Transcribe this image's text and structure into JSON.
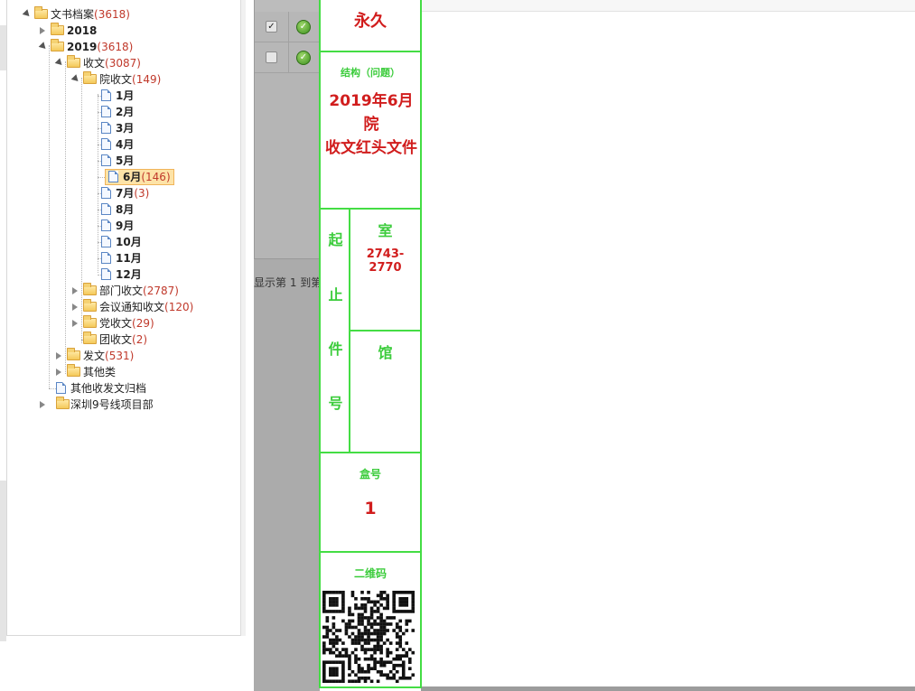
{
  "tree": {
    "root": {
      "label": "文书档案",
      "count": "(3618)"
    },
    "year_2018": {
      "label": "2018"
    },
    "year_2019": {
      "label": "2019",
      "count": "(3618)"
    },
    "receive": {
      "label": "收文",
      "count": "(3087)"
    },
    "inst_receive": {
      "label": "院收文",
      "count": "(149)"
    },
    "months": [
      {
        "label": "1月",
        "count": ""
      },
      {
        "label": "2月",
        "count": ""
      },
      {
        "label": "3月",
        "count": ""
      },
      {
        "label": "4月",
        "count": ""
      },
      {
        "label": "5月",
        "count": ""
      },
      {
        "label": "6月",
        "count": "(146)"
      },
      {
        "label": "7月",
        "count": "(3)"
      },
      {
        "label": "8月",
        "count": ""
      },
      {
        "label": "9月",
        "count": ""
      },
      {
        "label": "10月",
        "count": ""
      },
      {
        "label": "11月",
        "count": ""
      },
      {
        "label": "12月",
        "count": ""
      }
    ],
    "dept_receive": {
      "label": "部门收文",
      "count": "(2787)"
    },
    "meeting_receive": {
      "label": "会议通知收文",
      "count": "(120)"
    },
    "party_receive": {
      "label": "党收文",
      "count": "(29)"
    },
    "league_receive": {
      "label": "团收文",
      "count": "(2)"
    },
    "send": {
      "label": "发文",
      "count": "(531)"
    },
    "other": {
      "label": "其他类"
    },
    "other_archive": {
      "label": "其他收发文归档"
    },
    "project": {
      "label": "深圳9号线项目部"
    }
  },
  "grid": {
    "rows": [
      {
        "checked": true,
        "checkmark": "✓",
        "status_icon": "check-circle-icon"
      },
      {
        "checked": false,
        "checkmark": "",
        "status_icon": "check-circle-icon"
      }
    ],
    "pager_text": "显示第 1 到第"
  },
  "label": {
    "period": "永久",
    "title_header": "结构（问题）",
    "title_line1": "2019年6月院",
    "title_line2": "收文红头文件",
    "range_chars": [
      "起",
      "止",
      "件",
      "号"
    ],
    "room_header": "室",
    "room_value": "2743-2770",
    "hall_header": "馆",
    "box_header": "盒号",
    "box_value": "1",
    "qr_header": "二维码"
  },
  "colors": {
    "label_border": "#44dd44",
    "label_green_text": "#3ccc3c",
    "label_red_text": "#d11d1d",
    "count_red": "#c0392b",
    "selected_bg": "#fde3a7"
  }
}
